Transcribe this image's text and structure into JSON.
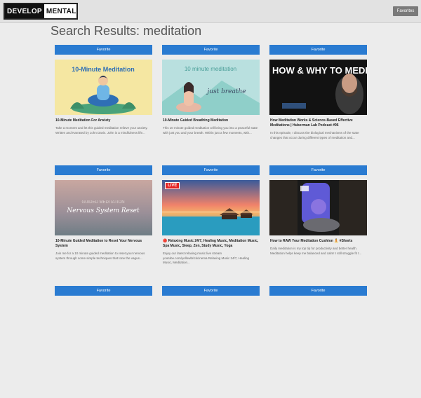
{
  "header": {
    "logo_dark": "DEVELOP",
    "logo_light": "MENTAL",
    "favorites_label": "Favorites"
  },
  "page_title": "Search Results: meditation",
  "cards": [
    {
      "button": "Favorite",
      "thumb_text": "10-Minute Meditation",
      "title": "10-Minute Meditation For Anxiety",
      "desc": "Take a moment and let this guided meditation relieve your anxiety. Written and Narrated by John Davis. John is a mindfulness life..."
    },
    {
      "button": "Favorite",
      "thumb_text": "10 minute meditation",
      "thumb_sub": "just breathe",
      "title": "10-Minute Guided Breathing Meditation",
      "desc": "This 10 minute guided meditation will bring you into a peaceful state with just you and your breath. Within just a few moments, with..."
    },
    {
      "button": "Favorite",
      "thumb_text": "HOW & WHY TO MEDITATE",
      "title": "How Meditation Works & Science-Based Effective Meditations | Huberman Lab Podcast #96",
      "desc": "In this episode, I discuss the biological mechanisms of the state changes that occur during different types of meditation and..."
    },
    {
      "button": "Favorite",
      "thumb_text": "GUIDED MEDITATION",
      "thumb_sub": "Nervous System Reset",
      "title": "10-Minute Guided Meditation to Reset Your Nervous System",
      "desc": "Join me for a 10 minute guided meditation to reset your nervous system through some simple techniques that tone the vagus..."
    },
    {
      "button": "Favorite",
      "badge": "LIVE",
      "title": "🔴 Relaxing Music 24/7, Healing Music, Meditation Music, Spa Music, Sleep, Zen, Study Music, Yoga",
      "desc": "Enjoy our latest relaxing music live stream youtube.com/yellowbrickcinema Relaxing Music 24/7, Healing Music, Meditation..."
    },
    {
      "button": "Favorite",
      "title": "How to RAW Your Meditation Cushion 🧘 #Shorts",
      "desc": "Daily meditation is my top tip for productivity and better health. Meditation helps keep me balanced and calm! I still struggle fit t..."
    },
    {
      "button": "Favorite"
    },
    {
      "button": "Favorite"
    },
    {
      "button": "Favorite"
    }
  ],
  "colors": {
    "button_blue": "#2a7bd1",
    "live_red": "#e52222"
  }
}
